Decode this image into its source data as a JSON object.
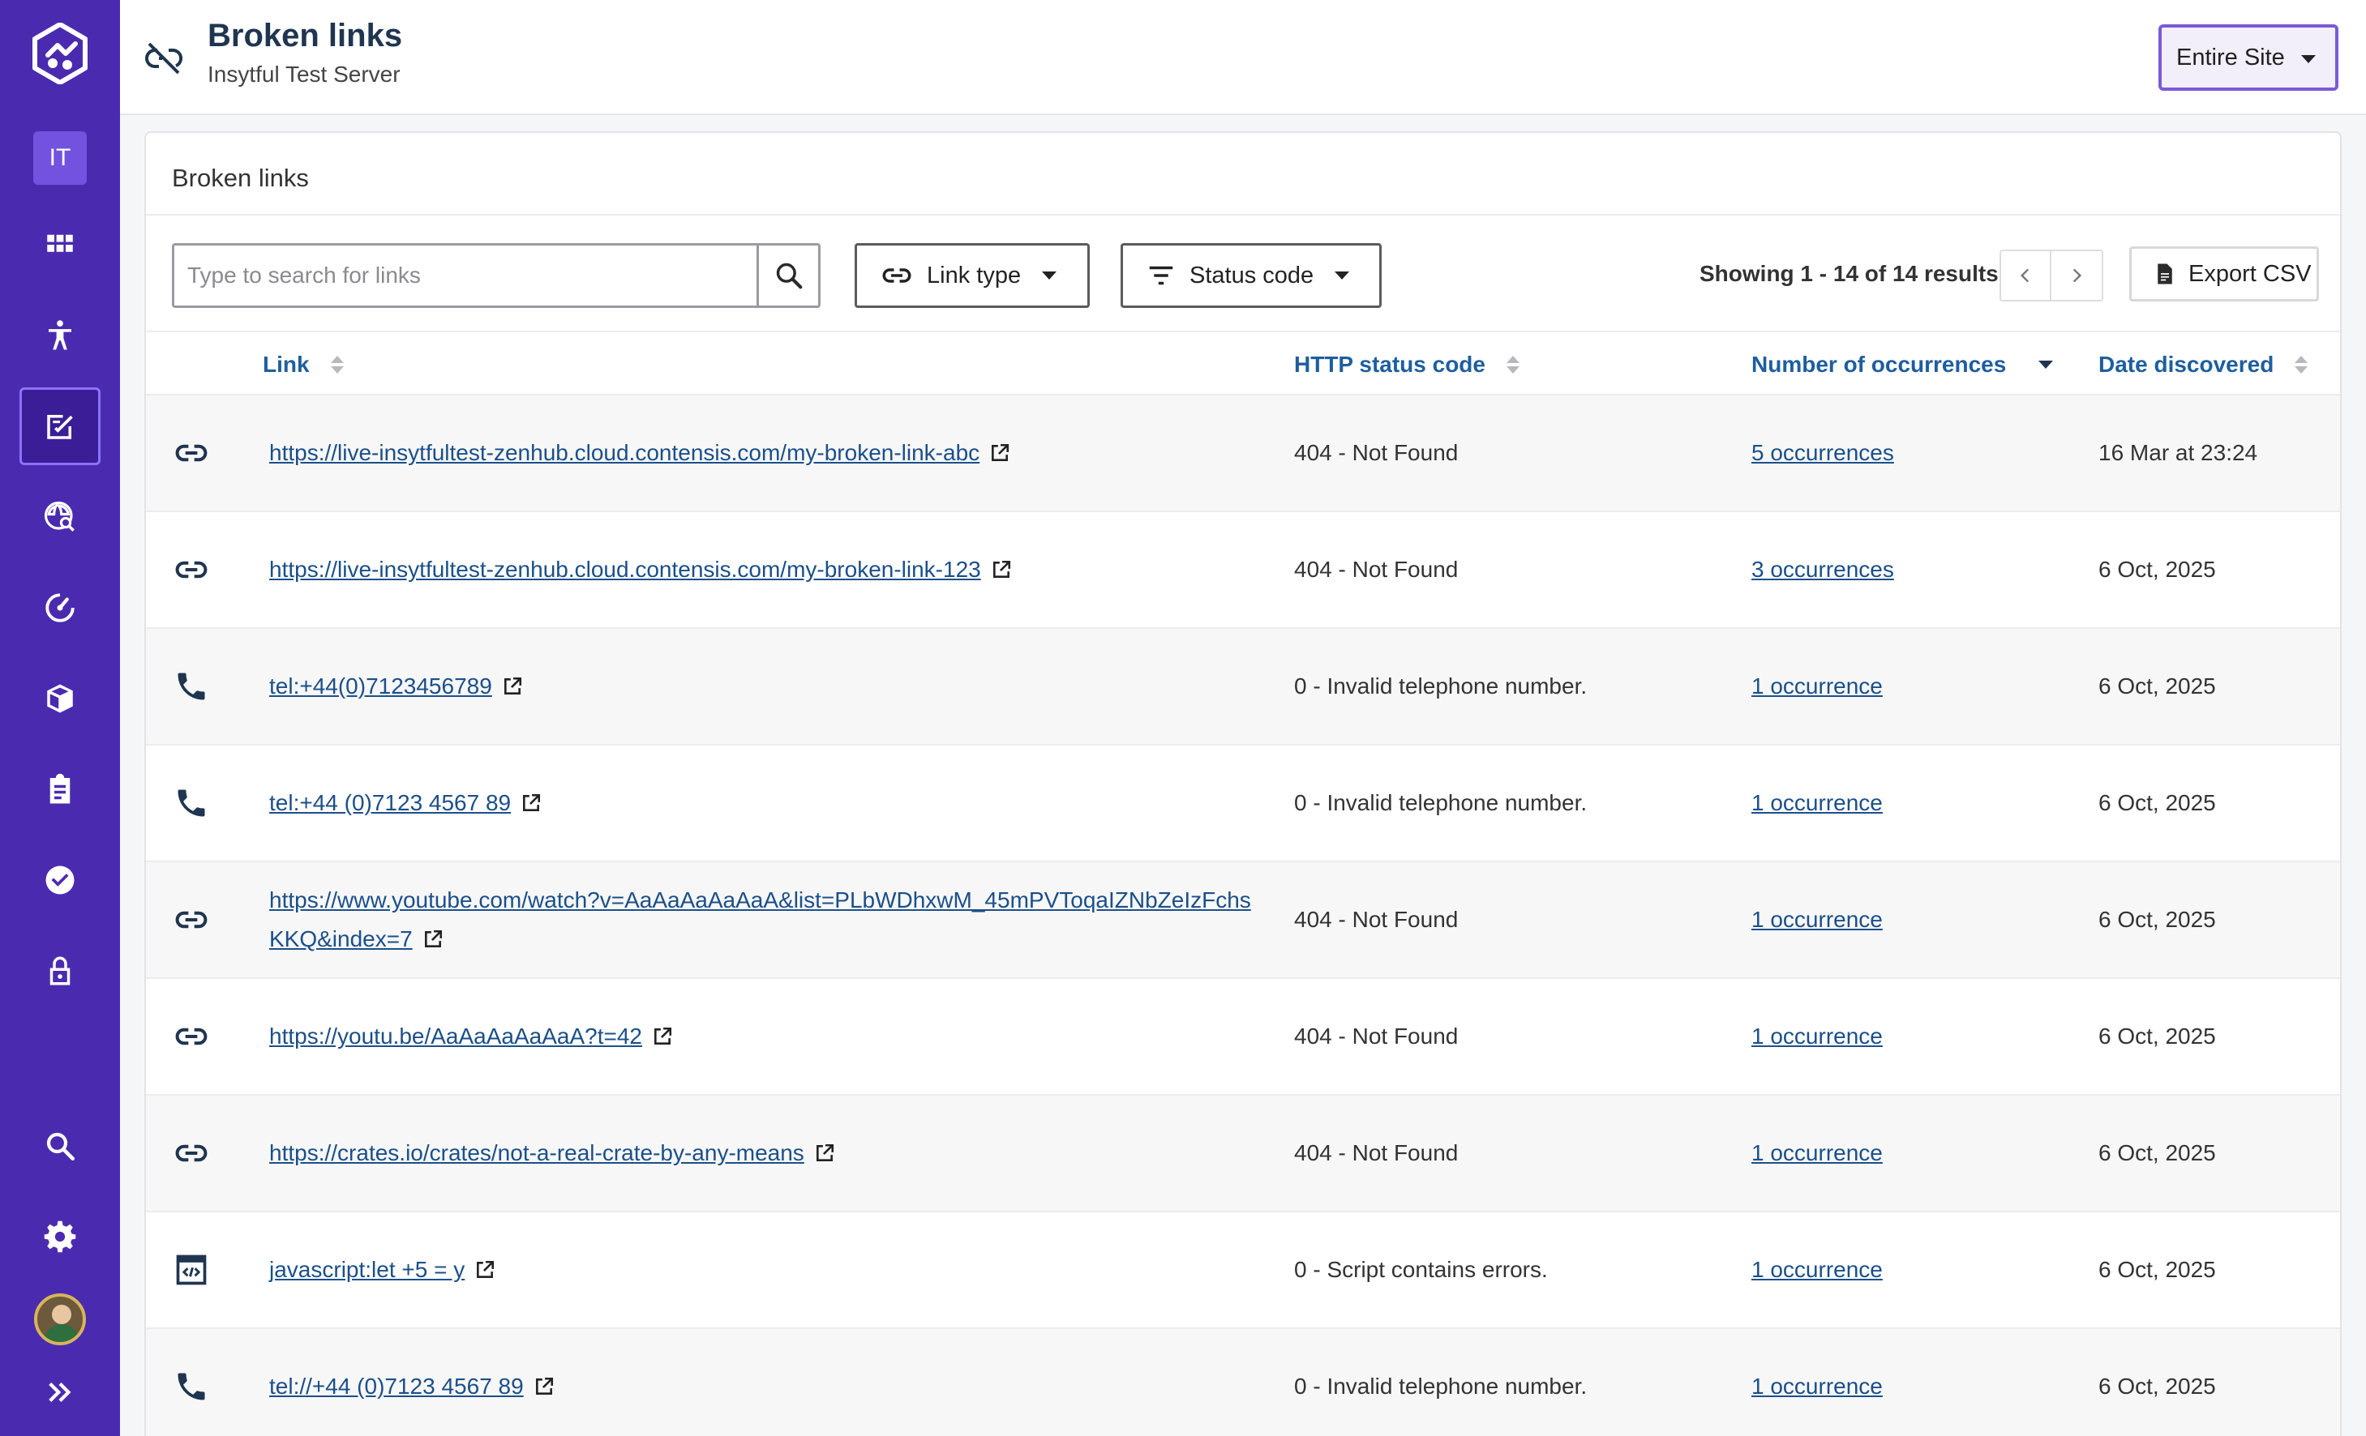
{
  "sidebar": {
    "org_badge": "IT",
    "items": [
      {
        "icon": "grid-icon"
      },
      {
        "icon": "accessibility-icon"
      },
      {
        "icon": "content-quality-icon",
        "active": true
      },
      {
        "icon": "globe-search-icon"
      },
      {
        "icon": "speed-gauge-icon"
      },
      {
        "icon": "cubes-icon"
      },
      {
        "icon": "clipboard-icon"
      },
      {
        "icon": "check-circle-icon"
      },
      {
        "icon": "lock-icon"
      }
    ],
    "bottom_items": [
      {
        "icon": "search-icon"
      },
      {
        "icon": "gear-icon"
      },
      {
        "icon": "avatar"
      },
      {
        "icon": "expand-icon"
      }
    ]
  },
  "header": {
    "title": "Broken links",
    "subtitle": "Insytful Test Server",
    "scope": "Entire Site"
  },
  "card": {
    "title": "Broken links"
  },
  "toolbar": {
    "search_placeholder": "Type to search for links",
    "link_type_label": "Link type",
    "status_code_label": "Status code",
    "results_text": "Showing 1 - 14 of 14 results",
    "export_label": "Export CSV"
  },
  "table": {
    "columns": {
      "link": "Link",
      "status": "HTTP status code",
      "occurrences": "Number of occurrences",
      "date": "Date discovered"
    },
    "rows": [
      {
        "type": "link",
        "url": "https://live-insytfultest-zenhub.cloud.contensis.com/my-broken-link-abc",
        "status": "404 - Not Found",
        "occurrences": "5 occurrences",
        "date": "16 Mar at 23:24"
      },
      {
        "type": "link",
        "url": "https://live-insytfultest-zenhub.cloud.contensis.com/my-broken-link-123",
        "status": "404 - Not Found",
        "occurrences": "3 occurrences",
        "date": "6 Oct, 2025"
      },
      {
        "type": "phone",
        "url": "tel:+44(0)7123456789",
        "status": "0 - Invalid telephone number.",
        "occurrences": "1 occurrence",
        "date": "6 Oct, 2025"
      },
      {
        "type": "phone",
        "url": "tel:+44 (0)7123 4567 89",
        "status": "0 - Invalid telephone number.",
        "occurrences": "1 occurrence",
        "date": "6 Oct, 2025"
      },
      {
        "type": "link",
        "url": "https://www.youtube.com/watch?v=AaAaAaAaAaA&list=PLbWDhxwM_45mPVToqaIZNbZeIzFchsKKQ&index=7",
        "status": "404 - Not Found",
        "occurrences": "1 occurrence",
        "date": "6 Oct, 2025"
      },
      {
        "type": "link",
        "url": "https://youtu.be/AaAaAaAaAaA?t=42",
        "status": "404 - Not Found",
        "occurrences": "1 occurrence",
        "date": "6 Oct, 2025"
      },
      {
        "type": "link",
        "url": "https://crates.io/crates/not-a-real-crate-by-any-means",
        "status": "404 - Not Found",
        "occurrences": "1 occurrence",
        "date": "6 Oct, 2025"
      },
      {
        "type": "script",
        "url": "javascript:let +5 = y",
        "status": "0 - Script contains errors.",
        "occurrences": "1 occurrence",
        "date": "6 Oct, 2025"
      },
      {
        "type": "phone",
        "url": "tel://+44 (0)7123 4567 89",
        "status": "0 - Invalid telephone number.",
        "occurrences": "1 occurrence",
        "date": "6 Oct, 2025"
      }
    ]
  }
}
